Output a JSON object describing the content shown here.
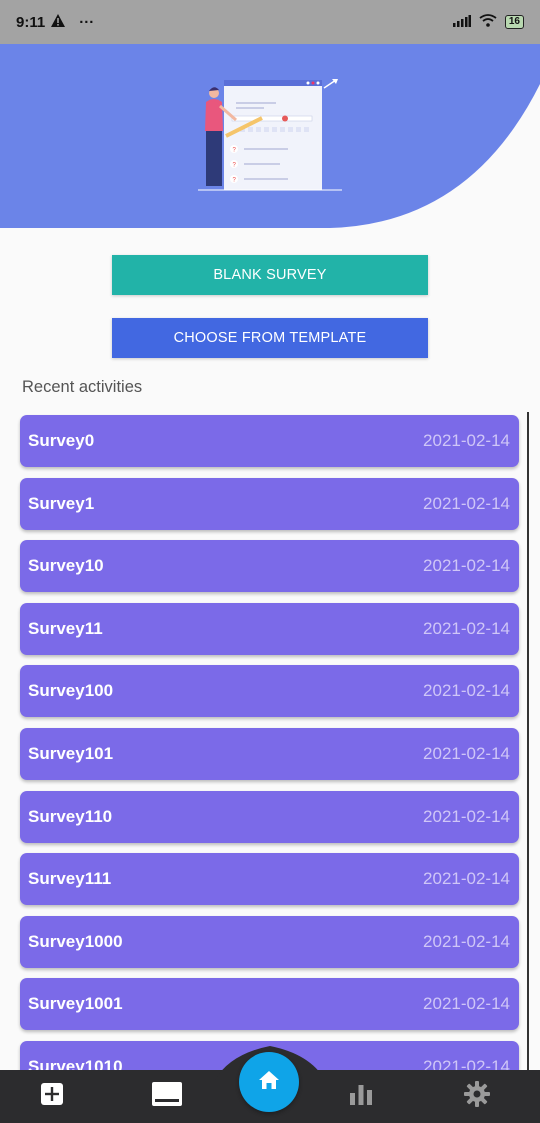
{
  "status_bar": {
    "time": "9:11",
    "alert_icon": "warning-icon",
    "more": "···",
    "battery": "16"
  },
  "actions": {
    "blank_survey": "BLANK SURVEY",
    "choose_template": "CHOOSE FROM TEMPLATE"
  },
  "recent": {
    "title": "Recent activities",
    "items": [
      {
        "name": "Survey0",
        "date": "2021-02-14"
      },
      {
        "name": "Survey1",
        "date": "2021-02-14"
      },
      {
        "name": "Survey10",
        "date": "2021-02-14"
      },
      {
        "name": "Survey11",
        "date": "2021-02-14"
      },
      {
        "name": "Survey100",
        "date": "2021-02-14"
      },
      {
        "name": "Survey101",
        "date": "2021-02-14"
      },
      {
        "name": "Survey110",
        "date": "2021-02-14"
      },
      {
        "name": "Survey111",
        "date": "2021-02-14"
      },
      {
        "name": "Survey1000",
        "date": "2021-02-14"
      },
      {
        "name": "Survey1001",
        "date": "2021-02-14"
      },
      {
        "name": "Survey1010",
        "date": "2021-02-14"
      }
    ]
  },
  "nav": {
    "items": [
      "add-icon",
      "list-icon",
      "home-icon",
      "bar-chart-icon",
      "gear-icon"
    ],
    "active": "home-icon"
  },
  "colors": {
    "header": "#6b84e8",
    "blank_button": "#22b3a8",
    "template_button": "#4268e1",
    "card": "#7b6ae8",
    "nav": "#2c2c2e",
    "home_button": "#0fa4e8"
  }
}
